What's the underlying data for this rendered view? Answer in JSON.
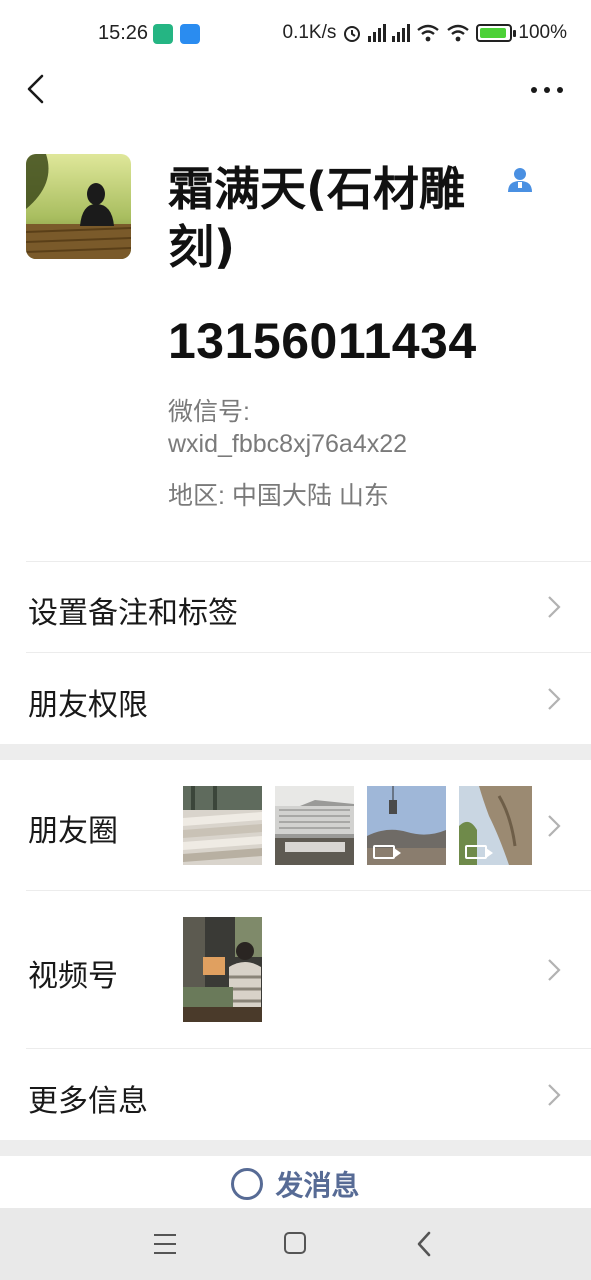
{
  "status_bar": {
    "time": "15:26",
    "net_speed": "0.1K/s",
    "battery": "100%"
  },
  "profile": {
    "name": "霜满天(石材雕刻)",
    "phone": "13156011434",
    "wechat_id_label": "微信号:",
    "wechat_id": "wxid_fbbc8xj76a4x22",
    "region": "地区:  中国大陆  山东"
  },
  "rows": {
    "remarks_tags": "设置备注和标签",
    "friend_permissions": "朋友权限",
    "moments": "朋友圈",
    "channels": "视频号",
    "more_info": "更多信息"
  },
  "actions": {
    "send_message": "发消息"
  },
  "icons": {
    "back": "chevron-left-icon",
    "more": "more-dots-icon",
    "contact": "person-icon",
    "row_chevron": "chevron-right-icon",
    "send": "chat-bubble-icon",
    "nav_menu": "menu-icon",
    "nav_home": "home-icon",
    "nav_back": "back-icon"
  },
  "colors": {
    "link_blue": "#576b95",
    "accent_blue": "#4a90e2",
    "divider": "#ececec",
    "band": "#ededed"
  }
}
